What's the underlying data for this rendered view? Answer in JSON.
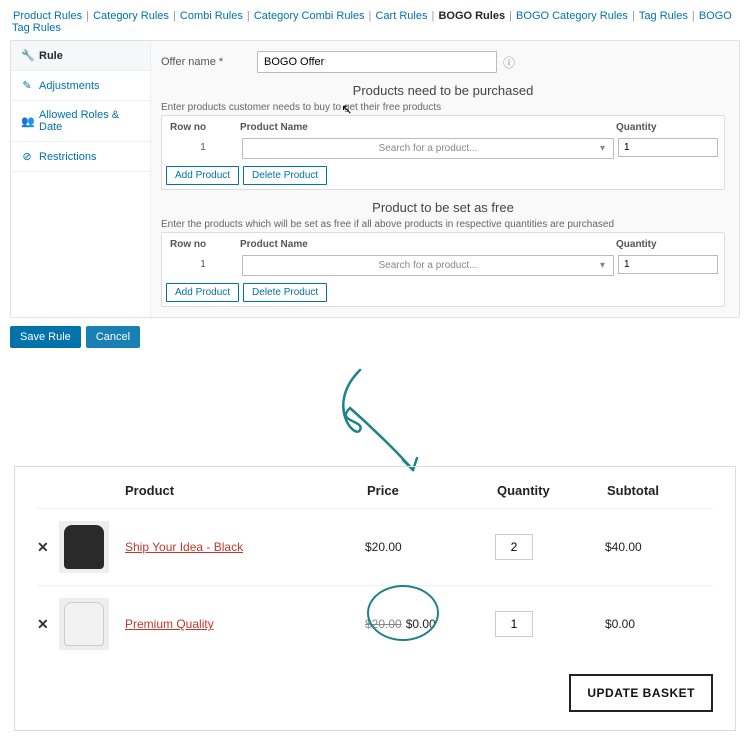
{
  "tabs": [
    {
      "label": "Product Rules",
      "active": false
    },
    {
      "label": "Category Rules",
      "active": false
    },
    {
      "label": "Combi Rules",
      "active": false
    },
    {
      "label": "Category Combi Rules",
      "active": false
    },
    {
      "label": "Cart Rules",
      "active": false
    },
    {
      "label": "BOGO Rules",
      "active": true
    },
    {
      "label": "BOGO Category Rules",
      "active": false
    },
    {
      "label": "Tag Rules",
      "active": false
    },
    {
      "label": "BOGO Tag Rules",
      "active": false
    }
  ],
  "sidebar": {
    "items": [
      {
        "icon": "🔧",
        "label": "Rule",
        "active": true
      },
      {
        "icon": "✎",
        "label": "Adjustments",
        "active": false
      },
      {
        "icon": "👥",
        "label": "Allowed Roles & Date",
        "active": false
      },
      {
        "icon": "⊘",
        "label": "Restrictions",
        "active": false
      }
    ]
  },
  "form": {
    "offer_label": "Offer name *",
    "offer_value": "BOGO Offer",
    "info_icon": "ⓘ",
    "section1_title": "Products need to be purchased",
    "section1_helper": "Enter products customer needs to buy to get their free products",
    "section2_title": "Product to be set as free",
    "section2_helper": "Enter the products which will be set as free if all above products in respective quantities are purchased",
    "cols": {
      "row": "Row no",
      "name": "Product Name",
      "qty": "Quantity"
    },
    "rows1": [
      {
        "no": "1",
        "placeholder": "Search for a product...",
        "qty": "1"
      }
    ],
    "rows2": [
      {
        "no": "1",
        "placeholder": "Search for a product...",
        "qty": "1"
      }
    ],
    "add_label": "Add Product",
    "del_label": "Delete Product"
  },
  "actions": {
    "save": "Save Rule",
    "cancel": "Cancel"
  },
  "cart": {
    "head": {
      "product": "Product",
      "price": "Price",
      "qty": "Quantity",
      "sub": "Subtotal"
    },
    "rows": [
      {
        "remove": "✕",
        "thumb": "black",
        "name": "Ship Your Idea - Black",
        "price": "$20.00",
        "strike": "",
        "qty": "2",
        "sub": "$40.00"
      },
      {
        "remove": "✕",
        "thumb": "white",
        "name": "Premium Quality",
        "price": "$0.00",
        "strike": "$20.00",
        "qty": "1",
        "sub": "$0.00"
      }
    ],
    "update": "UPDATE BASKET"
  },
  "annotation": {
    "arrow_color": "#1e828b"
  }
}
